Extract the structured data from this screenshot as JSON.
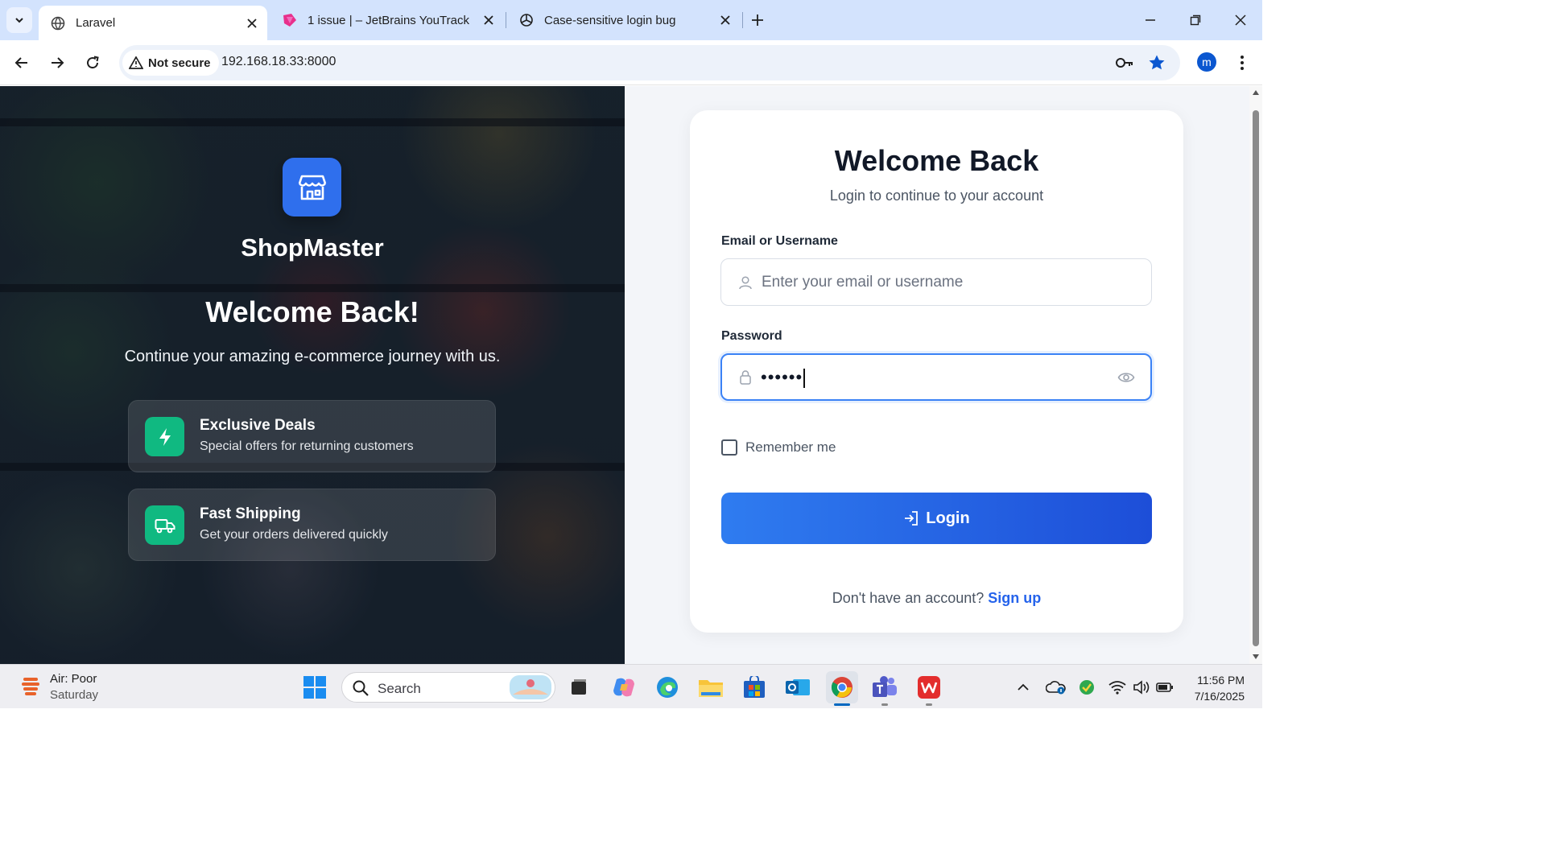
{
  "browser": {
    "tabs": [
      {
        "title": "Laravel",
        "active": true
      },
      {
        "title": "1 issue | – JetBrains YouTrack",
        "active": false
      },
      {
        "title": "Case-sensitive login bug",
        "active": false
      }
    ],
    "security_label": "Not secure",
    "url": "192.168.18.33:8000",
    "profile_initial": "m"
  },
  "hero": {
    "brand_name": "ShopMaster",
    "title": "Welcome Back!",
    "subtitle": "Continue your amazing e-commerce journey with us.",
    "features": [
      {
        "title": "Exclusive Deals",
        "description": "Special offers for returning customers",
        "icon": "lightning-icon"
      },
      {
        "title": "Fast Shipping",
        "description": "Get your orders delivered quickly",
        "icon": "truck-icon"
      }
    ]
  },
  "login": {
    "title": "Welcome Back",
    "subtitle": "Login to continue to your account",
    "email_label": "Email or Username",
    "email_placeholder": "Enter your email or username",
    "email_value": "",
    "password_label": "Password",
    "password_value": "••••••",
    "remember_label": "Remember me",
    "remember_checked": false,
    "submit_label": "Login",
    "signup_prompt": "Don't have an account?",
    "signup_link": "Sign up"
  },
  "taskbar": {
    "weather_title": "Air: Poor",
    "weather_subtitle": "Saturday",
    "search_placeholder": "Search",
    "time": "11:56 PM",
    "date": "7/16/2025"
  },
  "colors": {
    "primary": "#2563eb",
    "feature_green": "#10b981",
    "brand_blue": "#2f6fed"
  }
}
